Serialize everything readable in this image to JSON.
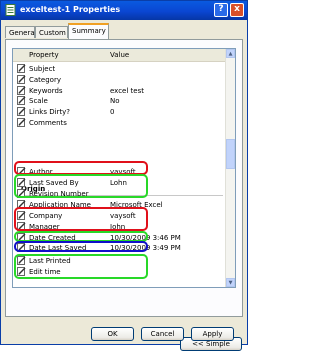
{
  "window": {
    "title": "exceltest-1 Properties",
    "help_label": "?",
    "close_label": "x"
  },
  "tabs": [
    {
      "label": "General"
    },
    {
      "label": "Custom"
    },
    {
      "label": "Summary"
    }
  ],
  "list": {
    "col_property": "Property",
    "col_value": "Value",
    "rows_top": [
      {
        "name": "Subject",
        "value": ""
      },
      {
        "name": "Category",
        "value": ""
      },
      {
        "name": "Keywords",
        "value": "excel test"
      },
      {
        "name": "Scale",
        "value": "No"
      },
      {
        "name": "Links Dirty?",
        "value": "0"
      },
      {
        "name": "Comments",
        "value": ""
      }
    ],
    "section_title": "Origin",
    "rows_origin": [
      {
        "name": "Author",
        "value": "vaysoft"
      },
      {
        "name": "Last Saved By",
        "value": "Lohn"
      },
      {
        "name": "Revision Number",
        "value": ""
      },
      {
        "name": "Application Name",
        "value": "Microsoft Excel"
      },
      {
        "name": "Company",
        "value": "vaysoft"
      },
      {
        "name": "Manager",
        "value": "John"
      },
      {
        "name": "Date Created",
        "value": "10/30/2009 3:46 PM"
      },
      {
        "name": "Date Last Saved",
        "value": "10/30/2009 3:49 PM"
      },
      {
        "name": "Last Printed",
        "value": ""
      },
      {
        "name": "Edit time",
        "value": ""
      }
    ]
  },
  "highlights": {
    "red": "#e0101a",
    "green": "#28d828",
    "blue": "#1010c8"
  },
  "buttons": {
    "simple": "<< Simple",
    "ok": "OK",
    "cancel": "Cancel",
    "apply": "Apply"
  }
}
